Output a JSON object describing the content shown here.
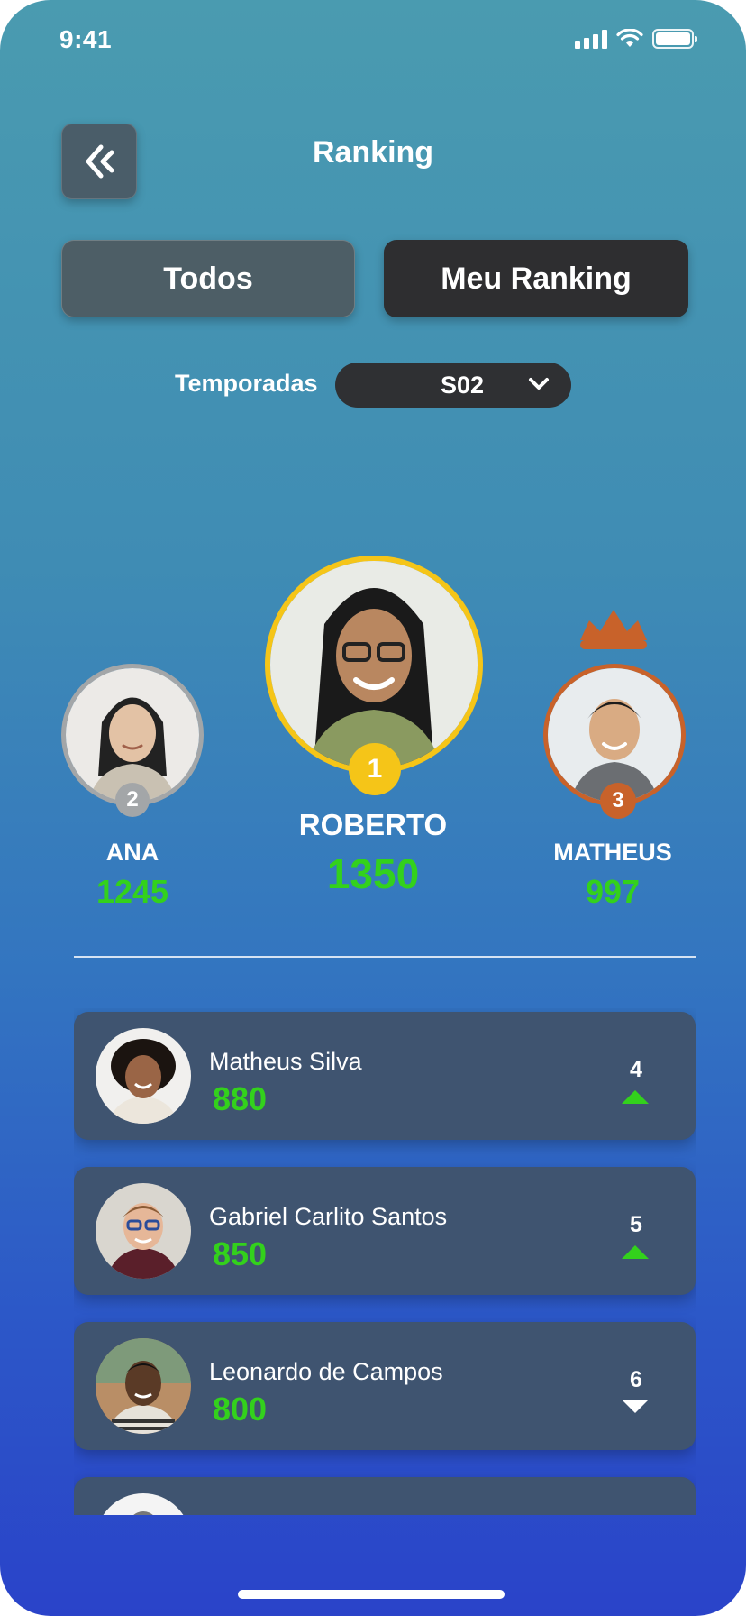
{
  "status_bar": {
    "time": "9:41"
  },
  "header": {
    "title": "Ranking"
  },
  "tabs": {
    "all_label": "Todos",
    "mine_label": "Meu Ranking"
  },
  "season": {
    "label": "Temporadas",
    "selected": "S02"
  },
  "podium": {
    "first": {
      "rank": "1",
      "name": "ROBERTO",
      "score": "1350"
    },
    "second": {
      "rank": "2",
      "name": "ANA",
      "score": "1245"
    },
    "third": {
      "rank": "3",
      "name": "MATHEUS",
      "score": "997"
    }
  },
  "list": [
    {
      "name": "Matheus Silva",
      "score": "880",
      "rank": "4",
      "trend": "up"
    },
    {
      "name": "Gabriel Carlito Santos",
      "score": "850",
      "rank": "5",
      "trend": "up"
    },
    {
      "name": "Leonardo de Campos",
      "score": "800",
      "rank": "6",
      "trend": "down"
    }
  ],
  "colors": {
    "gold": "#f5c518",
    "silver": "#a3a6a8",
    "bronze": "#c8622a",
    "score_green": "#33d11c"
  }
}
